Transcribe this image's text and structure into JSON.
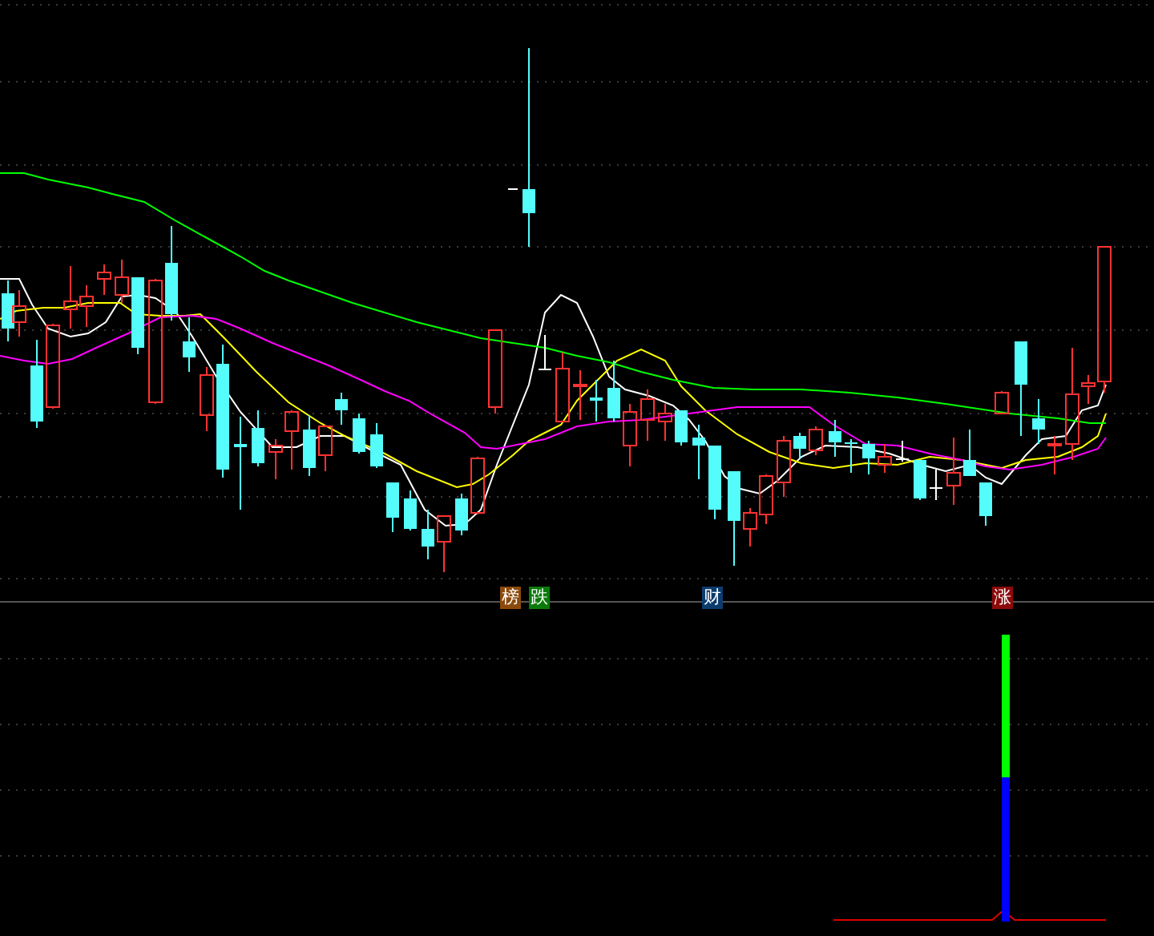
{
  "chart_markers": [
    {
      "label": "榜",
      "color": "#8b4a0c"
    },
    {
      "label": "跌",
      "color": "#0a7a0a"
    },
    {
      "label": "财",
      "color": "#0c3c6e"
    },
    {
      "label": "涨",
      "color": "#8c0a0a"
    }
  ]
}
